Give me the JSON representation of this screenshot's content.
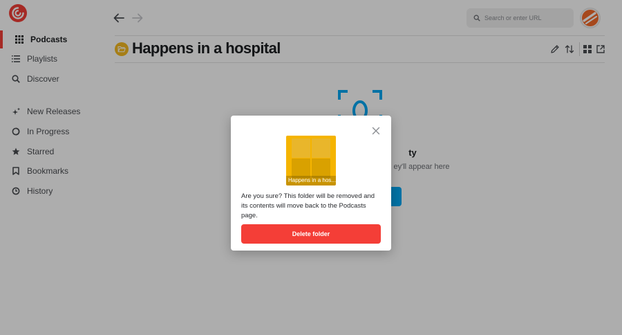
{
  "sidebar": {
    "items": [
      {
        "label": "Podcasts",
        "icon": "grid-icon",
        "active": true
      },
      {
        "label": "Playlists",
        "icon": "list-icon"
      },
      {
        "label": "Discover",
        "icon": "search-icon"
      },
      {
        "label": "New Releases",
        "icon": "sparkle-icon"
      },
      {
        "label": "In Progress",
        "icon": "progress-circle-icon"
      },
      {
        "label": "Starred",
        "icon": "star-icon"
      },
      {
        "label": "Bookmarks",
        "icon": "bookmark-icon"
      },
      {
        "label": "History",
        "icon": "history-icon"
      }
    ]
  },
  "header": {
    "search_placeholder": "Search or enter URL"
  },
  "page": {
    "title": "Happens in a hospital"
  },
  "empty_state": {
    "title_visible": "ty",
    "subtitle_visible": "ey'll appear here"
  },
  "modal": {
    "folder_art_caption": "Happens in a hos...",
    "message": "Are you sure? This folder will be removed and its contents will move back to the Podcasts page.",
    "delete_label": "Delete folder"
  },
  "colors": {
    "accent": "#f43e37",
    "folder": "#f5b400",
    "primary_blue": "#03a9f4"
  }
}
